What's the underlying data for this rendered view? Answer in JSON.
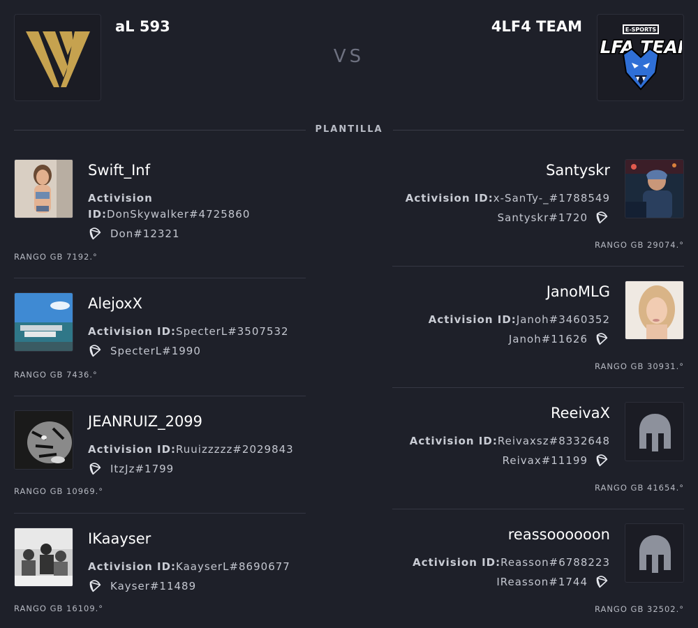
{
  "match": {
    "vs_label": "VS",
    "section_title": "PLANTILLA",
    "team_left": {
      "name": "aL 593",
      "logo": "gold-v-logo"
    },
    "team_right": {
      "name": "4LF4 TEAM",
      "logo": "wolf-esports-logo",
      "logo_text_top": "E-SPORTS",
      "logo_text": "ALFA TEAM"
    }
  },
  "colors": {
    "background": "#1e2029",
    "gold": "#c6a24f",
    "wolf_blue": "#2f6fd6"
  },
  "left_players": [
    {
      "name": "Swift_Inf",
      "aid_label": "Activision ID:",
      "aid": "DonSkywalker#4725860",
      "bnet": "Don#12321",
      "rank": "RANGO GB 7192.°",
      "avatar": "photo-avatar"
    },
    {
      "name": "AlejoxX",
      "aid_label": "Activision ID:",
      "aid": "SpecterL#3507532",
      "bnet": "SpecterL#1990",
      "rank": "RANGO GB 7436.°",
      "avatar": "harbor-photo-avatar"
    },
    {
      "name": "JEANRUIZ_2099",
      "aid_label": "Activision ID:",
      "aid": "Ruuizzzzz#2029843",
      "bnet": "ItzJz#1799",
      "rank": "RANGO GB 10969.°",
      "avatar": "tiger-photo-avatar"
    },
    {
      "name": "IKaayser",
      "aid_label": "Activision ID:",
      "aid": "KaayserL#8690677",
      "bnet": "Kayser#11489",
      "rank": "RANGO GB 16109.°",
      "avatar": "group-photo-avatar"
    }
  ],
  "right_players": [
    {
      "name": "Santyskr",
      "aid_label": "Activision ID:",
      "aid": "x-SanTy-_#1788549",
      "bnet": "Santyskr#1720",
      "rank": "RANGO GB 29074.°",
      "avatar": "gamer-photo-avatar"
    },
    {
      "name": "JanoMLG",
      "aid_label": "Activision ID:",
      "aid": "Janoh#3460352",
      "bnet": "Janoh#11626",
      "rank": "RANGO GB 30931.°",
      "avatar": "portrait-photo-avatar"
    },
    {
      "name": "ReeivaX",
      "aid_label": "Activision ID:",
      "aid": "Reivaxsz#8332648",
      "bnet": "Reivax#11199",
      "rank": "RANGO GB 41654.°",
      "avatar": "helmet-icon"
    },
    {
      "name": "reassoooooon",
      "aid_label": "Activision ID:",
      "aid": "Reasson#6788223",
      "bnet": "IReasson#1744",
      "rank": "RANGO GB 32502.°",
      "avatar": "helmet-icon"
    }
  ]
}
